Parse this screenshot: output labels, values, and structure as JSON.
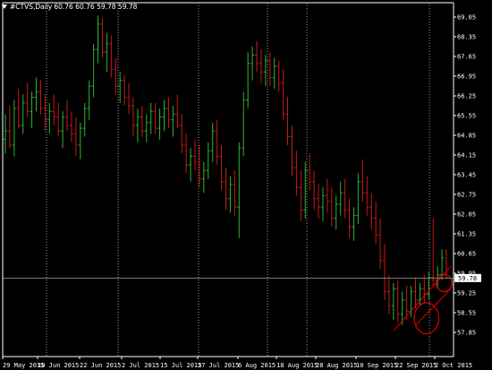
{
  "header": {
    "symbol": "#CTVS,Daily",
    "ohlc": "60.76 60.76 59.78 59.78"
  },
  "colors": {
    "background": "#000000",
    "up_bar": "#2db52d",
    "down_bar": "#c41a1a",
    "grid": "#ffffff",
    "axis_text": "#ffffff",
    "price_line": "#9aa0a8",
    "price_label_bg": "#ffffff",
    "annotation": "#e00000"
  },
  "chart_data": {
    "type": "ohlc",
    "title": "#CTVS,Daily",
    "grid": true,
    "ylim": [
      57.7,
      69.3
    ],
    "y_ticks": [
      "69.05",
      "68.35",
      "67.65",
      "66.95",
      "66.25",
      "65.55",
      "64.85",
      "64.15",
      "63.45",
      "62.75",
      "62.05",
      "61.35",
      "60.65",
      "59.95",
      "59.25",
      "58.55",
      "57.85"
    ],
    "x_ticks": [
      "29 May 2015",
      "10 Jun 2015",
      "22 Jun 2015",
      "2 Jul 2015",
      "15 Jul 2015",
      "27 Jul 2015",
      "6 Aug 2015",
      "18 Aug 2015",
      "28 Aug 2015",
      "10 Sep 2015",
      "22 Sep 2015",
      "2 Oct 2015"
    ],
    "last_price": "59.78",
    "series": [
      {
        "values": [
          [
            64.7,
            65.6,
            64.2,
            65.0
          ],
          [
            65.0,
            65.9,
            64.4,
            64.5
          ],
          [
            64.5,
            66.1,
            64.1,
            65.8
          ],
          [
            65.8,
            66.5,
            65.1,
            65.2
          ],
          [
            65.2,
            66.3,
            64.9,
            66.0
          ],
          [
            66.0,
            66.7,
            65.5,
            65.7
          ],
          [
            65.7,
            66.4,
            65.1,
            66.2
          ],
          [
            66.2,
            66.9,
            65.7,
            66.4
          ],
          [
            66.4,
            66.8,
            65.6,
            65.8
          ],
          [
            65.8,
            66.3,
            65.0,
            65.4
          ],
          [
            65.4,
            66.0,
            64.9,
            65.7
          ],
          [
            65.7,
            66.3,
            65.2,
            65.5
          ],
          [
            65.5,
            66.0,
            64.8,
            65.0
          ],
          [
            65.0,
            65.7,
            64.4,
            65.5
          ],
          [
            65.5,
            66.1,
            65.0,
            65.2
          ],
          [
            65.2,
            65.7,
            64.6,
            64.9
          ],
          [
            64.9,
            65.5,
            64.1,
            64.5
          ],
          [
            64.5,
            65.3,
            64.0,
            65.1
          ],
          [
            65.1,
            66.0,
            64.8,
            65.8
          ],
          [
            65.8,
            66.8,
            65.4,
            66.6
          ],
          [
            66.6,
            68.1,
            66.2,
            67.9
          ],
          [
            67.9,
            69.1,
            67.4,
            68.8
          ],
          [
            68.8,
            69.0,
            67.6,
            67.8
          ],
          [
            67.8,
            68.5,
            67.1,
            68.1
          ],
          [
            68.1,
            68.4,
            66.9,
            67.2
          ],
          [
            67.2,
            67.6,
            66.3,
            66.6
          ],
          [
            66.6,
            67.1,
            66.0,
            66.8
          ],
          [
            66.8,
            67.0,
            65.9,
            66.2
          ],
          [
            66.2,
            66.7,
            65.6,
            65.9
          ],
          [
            65.9,
            66.2,
            64.8,
            65.2
          ],
          [
            65.2,
            65.8,
            64.6,
            65.5
          ],
          [
            65.5,
            65.9,
            64.8,
            65.0
          ],
          [
            65.0,
            65.6,
            64.6,
            65.3
          ],
          [
            65.3,
            66.0,
            64.9,
            65.7
          ],
          [
            65.7,
            66.0,
            64.9,
            65.1
          ],
          [
            65.1,
            65.8,
            64.7,
            65.5
          ],
          [
            65.5,
            66.1,
            65.0,
            65.8
          ],
          [
            65.8,
            66.2,
            65.1,
            65.4
          ],
          [
            65.4,
            65.9,
            64.8,
            65.6
          ],
          [
            65.6,
            66.3,
            65.1,
            65.2
          ],
          [
            65.2,
            65.6,
            64.2,
            64.5
          ],
          [
            64.5,
            64.9,
            63.5,
            63.8
          ],
          [
            63.8,
            64.4,
            63.2,
            64.1
          ],
          [
            64.1,
            64.7,
            63.6,
            63.9
          ],
          [
            63.9,
            64.5,
            63.0,
            63.3
          ],
          [
            63.3,
            63.9,
            62.8,
            63.6
          ],
          [
            63.6,
            64.6,
            63.3,
            64.3
          ],
          [
            64.3,
            65.3,
            63.9,
            65.0
          ],
          [
            65.0,
            65.4,
            63.8,
            64.1
          ],
          [
            64.1,
            64.5,
            62.9,
            63.2
          ],
          [
            63.2,
            63.7,
            62.2,
            62.6
          ],
          [
            62.6,
            63.4,
            62.1,
            63.1
          ],
          [
            63.1,
            63.6,
            62.0,
            62.3
          ],
          [
            62.3,
            64.6,
            61.2,
            64.4
          ],
          [
            64.4,
            66.4,
            64.1,
            66.1
          ],
          [
            66.1,
            67.8,
            65.8,
            67.4
          ],
          [
            67.4,
            68.0,
            66.8,
            67.7
          ],
          [
            67.7,
            68.2,
            67.1,
            67.4
          ],
          [
            67.4,
            67.9,
            66.7,
            67.1
          ],
          [
            67.1,
            67.7,
            66.6,
            67.5
          ],
          [
            67.5,
            67.8,
            66.6,
            66.9
          ],
          [
            66.9,
            67.6,
            66.5,
            67.3
          ],
          [
            67.3,
            67.5,
            66.4,
            66.7
          ],
          [
            66.7,
            67.2,
            65.4,
            65.6
          ],
          [
            65.6,
            66.2,
            64.5,
            64.8
          ],
          [
            64.8,
            65.2,
            63.4,
            63.7
          ],
          [
            63.7,
            64.3,
            62.7,
            63.0
          ],
          [
            63.0,
            63.6,
            61.8,
            62.2
          ],
          [
            62.2,
            63.9,
            61.9,
            63.6
          ],
          [
            63.6,
            64.2,
            62.9,
            63.2
          ],
          [
            63.2,
            63.6,
            62.2,
            62.6
          ],
          [
            62.6,
            63.1,
            61.9,
            62.3
          ],
          [
            62.3,
            63.0,
            61.8,
            62.7
          ],
          [
            62.7,
            63.3,
            62.1,
            62.5
          ],
          [
            62.5,
            63.0,
            61.6,
            61.9
          ],
          [
            61.9,
            62.7,
            61.5,
            62.4
          ],
          [
            62.4,
            63.2,
            62.0,
            62.8
          ],
          [
            62.8,
            63.3,
            61.9,
            62.2
          ],
          [
            62.2,
            62.6,
            61.2,
            61.6
          ],
          [
            61.6,
            62.3,
            61.1,
            62.0
          ],
          [
            62.0,
            63.5,
            61.7,
            63.2
          ],
          [
            63.2,
            64.0,
            62.5,
            62.8
          ],
          [
            62.8,
            63.4,
            62.0,
            62.3
          ],
          [
            62.3,
            62.8,
            61.5,
            61.9
          ],
          [
            61.9,
            62.5,
            61.0,
            61.3
          ],
          [
            61.3,
            61.9,
            60.1,
            60.4
          ],
          [
            60.4,
            61.0,
            59.0,
            59.3
          ],
          [
            59.3,
            59.9,
            58.5,
            58.8
          ],
          [
            58.8,
            59.6,
            58.3,
            59.4
          ],
          [
            59.4,
            59.7,
            58.2,
            58.5
          ],
          [
            58.5,
            59.3,
            58.1,
            59.0
          ],
          [
            59.0,
            59.5,
            58.3,
            58.6
          ],
          [
            58.6,
            59.5,
            58.4,
            59.3
          ],
          [
            59.3,
            59.8,
            58.7,
            59.0
          ],
          [
            59.0,
            59.6,
            58.8,
            59.4
          ],
          [
            59.4,
            59.9,
            58.9,
            59.2
          ],
          [
            59.2,
            60.0,
            59.0,
            59.8
          ],
          [
            59.8,
            61.9,
            59.5,
            59.7
          ],
          [
            59.7,
            60.2,
            59.4,
            59.9
          ],
          [
            59.9,
            60.8,
            59.7,
            60.5
          ],
          [
            60.76,
            60.76,
            59.78,
            59.78
          ]
        ]
      }
    ],
    "annotations": [
      {
        "type": "trendline",
        "from_bar": 88,
        "from_price": 57.9,
        "to_bar": 101,
        "to_price": 60.2
      },
      {
        "type": "trendline",
        "from_bar": 93,
        "from_price": 58.1,
        "to_bar": 101,
        "to_price": 59.4
      },
      {
        "type": "ellipse",
        "cx_bar": 95.5,
        "cy_price": 58.35,
        "rx_bars": 2.8,
        "ry_price": 0.55
      },
      {
        "type": "ellipse",
        "cx_bar": 99.5,
        "cy_price": 59.6,
        "rx_bars": 1.8,
        "ry_price": 0.3
      }
    ]
  }
}
